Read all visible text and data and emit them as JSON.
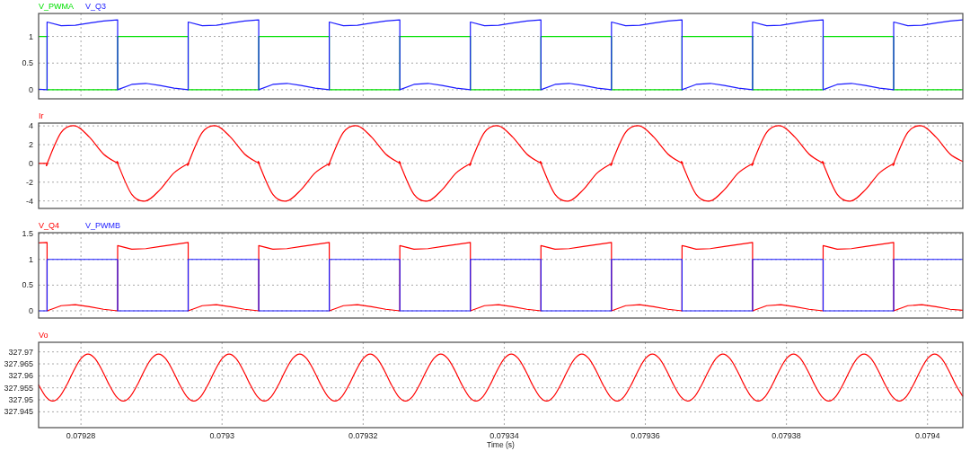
{
  "charts": [
    {
      "chart_data": {
        "type": "line",
        "grid": true,
        "xlim": [
          0.079274,
          0.079405
        ],
        "ylim": [
          -0.17,
          1.43
        ],
        "yticks": [
          0,
          0.5,
          1
        ],
        "x": [
          0.079274,
          0.0792752,
          0.0792752,
          0.0792772,
          0.0792792,
          0.0792812,
          0.0792832,
          0.0792852,
          0.0792852,
          0.0792872,
          0.0792892,
          0.0792912,
          0.0792932,
          0.0792952,
          0.0792952,
          0.0792972,
          0.0792992,
          0.0793012,
          0.0793032,
          0.0793052,
          0.0793052,
          0.0793072,
          0.0793092,
          0.0793112,
          0.0793132,
          0.0793152,
          0.0793152,
          0.0793172,
          0.0793192,
          0.0793212,
          0.0793232,
          0.0793252,
          0.0793252,
          0.0793272,
          0.0793292,
          0.0793312,
          0.0793332,
          0.0793352,
          0.0793352,
          0.0793372,
          0.0793392,
          0.0793412,
          0.0793432,
          0.0793452,
          0.0793452,
          0.0793472,
          0.0793492,
          0.0793512,
          0.0793532,
          0.0793552,
          0.0793552,
          0.0793572,
          0.0793592,
          0.0793612,
          0.0793632,
          0.0793652,
          0.0793652,
          0.0793672,
          0.0793692,
          0.0793712,
          0.0793732,
          0.0793752,
          0.0793752,
          0.0793772,
          0.0793792,
          0.0793812,
          0.0793832,
          0.0793852,
          0.0793852,
          0.0793872,
          0.0793892,
          0.0793912,
          0.0793932,
          0.0793952,
          0.0793952,
          0.0793972,
          0.0793992,
          0.0794012,
          0.0794032,
          0.079405
        ],
        "series": [
          {
            "name": "V_PWMA",
            "color": "#00e000",
            "values": [
              1,
              1,
              0,
              0,
              0,
              0,
              0,
              0,
              1,
              1,
              1,
              1,
              1,
              1,
              0,
              0,
              0,
              0,
              0,
              0,
              1,
              1,
              1,
              1,
              1,
              1,
              0,
              0,
              0,
              0,
              0,
              0,
              1,
              1,
              1,
              1,
              1,
              1,
              0,
              0,
              0,
              0,
              0,
              0,
              1,
              1,
              1,
              1,
              1,
              1,
              0,
              0,
              0,
              0,
              0,
              0,
              1,
              1,
              1,
              1,
              1,
              1,
              0,
              0,
              0,
              0,
              0,
              0,
              1,
              1,
              1,
              1,
              1,
              1,
              0,
              0,
              0,
              0,
              0,
              0
            ]
          },
          {
            "name": "V_Q3",
            "color": "#1a1aff",
            "values": [
              0.01,
              0,
              1.27,
              1.2,
              1.21,
              1.25,
              1.29,
              1.31,
              0,
              0.1,
              0.12,
              0.08,
              0.03,
              0,
              1.27,
              1.2,
              1.21,
              1.25,
              1.29,
              1.31,
              0,
              0.1,
              0.12,
              0.08,
              0.03,
              0,
              1.27,
              1.2,
              1.21,
              1.25,
              1.29,
              1.31,
              0,
              0.1,
              0.12,
              0.08,
              0.03,
              0,
              1.27,
              1.2,
              1.21,
              1.25,
              1.29,
              1.31,
              0,
              0.1,
              0.12,
              0.08,
              0.03,
              0,
              1.27,
              1.2,
              1.21,
              1.25,
              1.29,
              1.31,
              0,
              0.1,
              0.12,
              0.08,
              0.03,
              0,
              1.27,
              1.2,
              1.21,
              1.25,
              1.29,
              1.31,
              0,
              0.1,
              0.12,
              0.08,
              0.03,
              0,
              1.27,
              1.2,
              1.21,
              1.25,
              1.29,
              1.31
            ]
          }
        ]
      }
    },
    {
      "chart_data": {
        "type": "line",
        "grid": true,
        "xlim": [
          0.079274,
          0.079405
        ],
        "ylim": [
          -4.8,
          4.3
        ],
        "yticks": [
          -4,
          -2,
          0,
          2,
          4
        ],
        "x": [
          0.079274,
          0.0792752,
          0.0792752,
          0.0792772,
          0.0792792,
          0.0792812,
          0.0792832,
          0.0792852,
          0.0792852,
          0.0792872,
          0.0792892,
          0.0792912,
          0.0792932,
          0.0792952,
          0.0792952,
          0.0792972,
          0.0792992,
          0.0793012,
          0.0793032,
          0.0793052,
          0.0793052,
          0.0793072,
          0.0793092,
          0.0793112,
          0.0793132,
          0.0793152,
          0.0793152,
          0.0793172,
          0.0793192,
          0.0793212,
          0.0793232,
          0.0793252,
          0.0793252,
          0.0793272,
          0.0793292,
          0.0793312,
          0.0793332,
          0.0793352,
          0.0793352,
          0.0793372,
          0.0793392,
          0.0793412,
          0.0793432,
          0.0793452,
          0.0793452,
          0.0793472,
          0.0793492,
          0.0793512,
          0.0793532,
          0.0793552,
          0.0793552,
          0.0793572,
          0.0793592,
          0.0793612,
          0.0793632,
          0.0793652,
          0.0793652,
          0.0793672,
          0.0793692,
          0.0793712,
          0.0793732,
          0.0793752,
          0.0793752,
          0.0793772,
          0.0793792,
          0.0793812,
          0.0793832,
          0.0793852,
          0.0793852,
          0.0793872,
          0.0793892,
          0.0793912,
          0.0793932,
          0.0793952,
          0.0793952,
          0.0793972,
          0.0793992,
          0.0794012,
          0.0794032,
          0.079405
        ],
        "series": [
          {
            "name": "Ir",
            "color": "#ff0000",
            "values": [
              0,
              0,
              0,
              3.3,
              4,
              2.8,
              1,
              0,
              0,
              -3.3,
              -4,
              -2.8,
              -1,
              0,
              0,
              3.3,
              4,
              2.8,
              1,
              0,
              0,
              -3.3,
              -4,
              -2.8,
              -1,
              0,
              0,
              3.3,
              4,
              2.8,
              1,
              0,
              0,
              -3.3,
              -4,
              -2.8,
              -1,
              0,
              0,
              3.3,
              4,
              2.8,
              1,
              0,
              0,
              -3.3,
              -4,
              -2.8,
              -1,
              0,
              0,
              3.3,
              4,
              2.8,
              1,
              0,
              0,
              -3.3,
              -4,
              -2.8,
              -1,
              0,
              0,
              3.3,
              4,
              2.8,
              1,
              0,
              0,
              -3.3,
              -4,
              -2.8,
              -1,
              0,
              0,
              3.3,
              4,
              2.8,
              1,
              0.2
            ]
          }
        ]
      }
    },
    {
      "chart_data": {
        "type": "line",
        "grid": true,
        "xlim": [
          0.079274,
          0.079405
        ],
        "ylim": [
          -0.14,
          1.52
        ],
        "yticks": [
          0,
          0.5,
          1,
          1.5
        ],
        "x": [
          0.079274,
          0.0792752,
          0.0792752,
          0.0792772,
          0.0792792,
          0.0792812,
          0.0792832,
          0.0792852,
          0.0792852,
          0.0792872,
          0.0792892,
          0.0792912,
          0.0792932,
          0.0792952,
          0.0792952,
          0.0792972,
          0.0792992,
          0.0793012,
          0.0793032,
          0.0793052,
          0.0793052,
          0.0793072,
          0.0793092,
          0.0793112,
          0.0793132,
          0.0793152,
          0.0793152,
          0.0793172,
          0.0793192,
          0.0793212,
          0.0793232,
          0.0793252,
          0.0793252,
          0.0793272,
          0.0793292,
          0.0793312,
          0.0793332,
          0.0793352,
          0.0793352,
          0.0793372,
          0.0793392,
          0.0793412,
          0.0793432,
          0.0793452,
          0.0793452,
          0.0793472,
          0.0793492,
          0.0793512,
          0.0793532,
          0.0793552,
          0.0793552,
          0.0793572,
          0.0793592,
          0.0793612,
          0.0793632,
          0.0793652,
          0.0793652,
          0.0793672,
          0.0793692,
          0.0793712,
          0.0793732,
          0.0793752,
          0.0793752,
          0.0793772,
          0.0793792,
          0.0793812,
          0.0793832,
          0.0793852,
          0.0793852,
          0.0793872,
          0.0793892,
          0.0793912,
          0.0793932,
          0.0793952,
          0.0793952,
          0.0793972,
          0.0793992,
          0.0794012,
          0.0794032,
          0.079405
        ],
        "series": [
          {
            "name": "V_Q4",
            "color": "#ff0000",
            "values": [
              1.32,
              1.33,
              0,
              0.1,
              0.12,
              0.08,
              0.03,
              0,
              1.27,
              1.2,
              1.21,
              1.25,
              1.29,
              1.33,
              0,
              0.1,
              0.12,
              0.08,
              0.03,
              0,
              1.27,
              1.2,
              1.21,
              1.25,
              1.29,
              1.33,
              0,
              0.1,
              0.12,
              0.08,
              0.03,
              0,
              1.27,
              1.2,
              1.21,
              1.25,
              1.29,
              1.33,
              0,
              0.1,
              0.12,
              0.08,
              0.03,
              0,
              1.27,
              1.2,
              1.21,
              1.25,
              1.29,
              1.33,
              0,
              0.1,
              0.12,
              0.08,
              0.03,
              0,
              1.27,
              1.2,
              1.21,
              1.25,
              1.29,
              1.33,
              0,
              0.1,
              0.12,
              0.08,
              0.03,
              0,
              1.27,
              1.2,
              1.21,
              1.25,
              1.29,
              1.33,
              0,
              0.1,
              0.12,
              0.08,
              0.03,
              0.01
            ]
          },
          {
            "name": "V_PWMB",
            "color": "#1a1aff",
            "values": [
              0,
              0,
              1,
              1,
              1,
              1,
              1,
              1,
              0,
              0,
              0,
              0,
              0,
              0,
              1,
              1,
              1,
              1,
              1,
              1,
              0,
              0,
              0,
              0,
              0,
              0,
              1,
              1,
              1,
              1,
              1,
              1,
              0,
              0,
              0,
              0,
              0,
              0,
              1,
              1,
              1,
              1,
              1,
              1,
              0,
              0,
              0,
              0,
              0,
              0,
              1,
              1,
              1,
              1,
              1,
              1,
              0,
              0,
              0,
              0,
              0,
              0,
              1,
              1,
              1,
              1,
              1,
              1,
              0,
              0,
              0,
              0,
              0,
              0,
              1,
              1,
              1,
              1,
              1,
              1
            ]
          }
        ]
      }
    },
    {
      "chart_data": {
        "type": "line",
        "grid": true,
        "xlabel": "Time (s)",
        "xlim": [
          0.079274,
          0.079405
        ],
        "ylim": [
          327.9384,
          327.974
        ],
        "xticks": [
          0.07928,
          0.0793,
          0.07932,
          0.07934,
          0.07936,
          0.07938,
          0.0794
        ],
        "yticks": [
          327.945,
          327.95,
          327.955,
          327.96,
          327.965,
          327.97
        ],
        "x": [
          0.079274,
          0.079275,
          0.079276,
          0.079277,
          0.079278,
          0.079279,
          0.07928,
          0.079281,
          0.079282,
          0.079283,
          0.079284,
          0.079285,
          0.079286,
          0.079287,
          0.079288,
          0.079289,
          0.07929,
          0.079291,
          0.079292,
          0.079293,
          0.079294,
          0.079295,
          0.079296,
          0.079297,
          0.079298,
          0.079299,
          0.0793,
          0.079301,
          0.079302,
          0.079303,
          0.079304,
          0.079305,
          0.079306,
          0.079307,
          0.079308,
          0.079309,
          0.07931,
          0.079311,
          0.079312,
          0.079313,
          0.079314,
          0.079315,
          0.079316,
          0.079317,
          0.079318,
          0.079319,
          0.07932,
          0.079321,
          0.079322,
          0.079323,
          0.079324,
          0.079325,
          0.079326,
          0.079327,
          0.079328,
          0.079329,
          0.07933,
          0.079331,
          0.079332,
          0.079333,
          0.079334,
          0.079335,
          0.079336,
          0.079337,
          0.079338,
          0.079339,
          0.07934,
          0.079341,
          0.079342,
          0.079343,
          0.079344,
          0.079345,
          0.079346,
          0.079347,
          0.079348,
          0.079349,
          0.07935,
          0.079351,
          0.079352,
          0.079353,
          0.079354,
          0.079355,
          0.079356,
          0.079357,
          0.079358,
          0.079359,
          0.07936,
          0.079361,
          0.079362,
          0.079363,
          0.079364,
          0.079365,
          0.079366,
          0.079367,
          0.079368,
          0.079369,
          0.07937,
          0.079371,
          0.079372,
          0.079373,
          0.079374,
          0.079375,
          0.079376,
          0.079377,
          0.079378,
          0.079379,
          0.07938,
          0.079381,
          0.079382,
          0.079383,
          0.079384,
          0.079385,
          0.079386,
          0.079387,
          0.079388,
          0.079389,
          0.07939,
          0.079391,
          0.079392,
          0.079393,
          0.079394,
          0.079395,
          0.079396,
          0.079397,
          0.079398,
          0.079399,
          0.0794,
          0.079401,
          0.079402,
          0.079403,
          0.079404,
          0.079405
        ],
        "series": [
          {
            "name": "Vo",
            "color": "#ff0000",
            "values": [
              327.9563,
              327.9514,
              327.9495,
              327.9514,
              327.9563,
              327.9623,
              327.9672,
              327.9691,
              327.9672,
              327.9623,
              327.9563,
              327.9514,
              327.9495,
              327.9514,
              327.9563,
              327.9623,
              327.9672,
              327.9691,
              327.9672,
              327.9623,
              327.9563,
              327.9514,
              327.9495,
              327.9514,
              327.9563,
              327.9623,
              327.9672,
              327.9691,
              327.9672,
              327.9623,
              327.9563,
              327.9514,
              327.9495,
              327.9514,
              327.9563,
              327.9623,
              327.9672,
              327.9691,
              327.9672,
              327.9623,
              327.9563,
              327.9514,
              327.9495,
              327.9514,
              327.9563,
              327.9623,
              327.9672,
              327.9691,
              327.9672,
              327.9623,
              327.9563,
              327.9514,
              327.9495,
              327.9514,
              327.9563,
              327.9623,
              327.9672,
              327.9691,
              327.9672,
              327.9623,
              327.9563,
              327.9514,
              327.9495,
              327.9514,
              327.9563,
              327.9623,
              327.9672,
              327.9691,
              327.9672,
              327.9623,
              327.9563,
              327.9514,
              327.9495,
              327.9514,
              327.9563,
              327.9623,
              327.9672,
              327.9691,
              327.9672,
              327.9623,
              327.9563,
              327.9514,
              327.9495,
              327.9514,
              327.9563,
              327.9623,
              327.9672,
              327.9691,
              327.9672,
              327.9623,
              327.9563,
              327.9514,
              327.9495,
              327.9514,
              327.9563,
              327.9623,
              327.9672,
              327.9691,
              327.9672,
              327.9623,
              327.9563,
              327.9514,
              327.9495,
              327.9514,
              327.9563,
              327.9623,
              327.9672,
              327.9691,
              327.9672,
              327.9623,
              327.9563,
              327.9514,
              327.9495,
              327.9514,
              327.9563,
              327.9623,
              327.9672,
              327.9691,
              327.9672,
              327.9623,
              327.9563,
              327.9514,
              327.9495,
              327.9514,
              327.9563,
              327.9623,
              327.9672,
              327.9691,
              327.9672,
              327.9623,
              327.9563,
              327.9514
            ]
          }
        ]
      }
    }
  ]
}
